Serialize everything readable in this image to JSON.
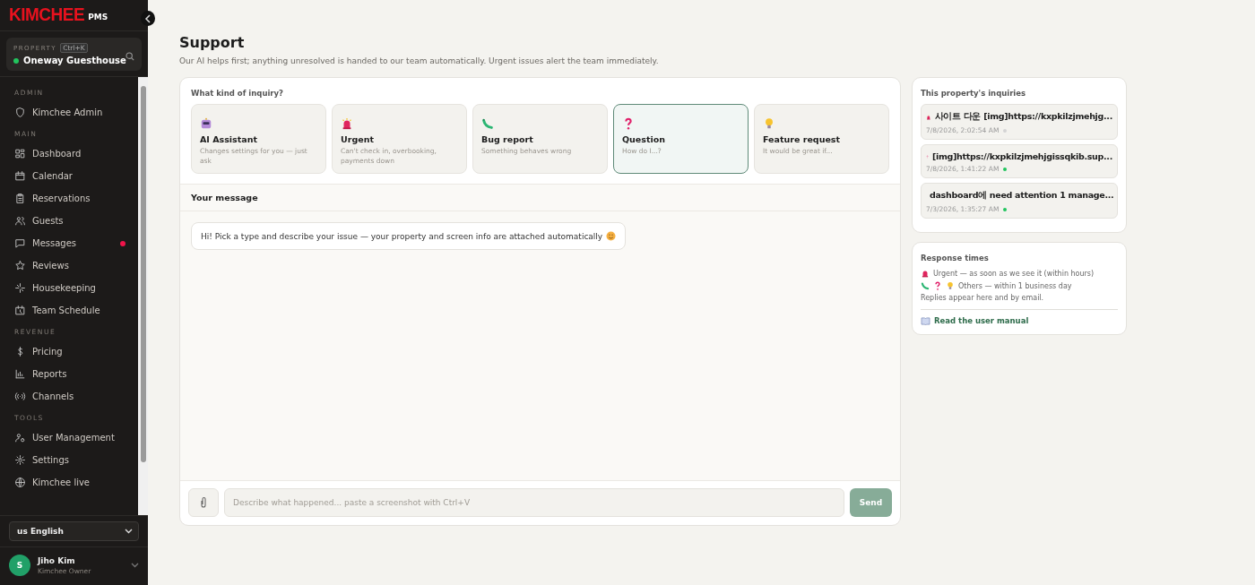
{
  "sidebar": {
    "logo": "KIMCHEE",
    "logo_suffix": "PMS",
    "property": {
      "label": "PROPERTY",
      "shortcut": "Ctrl+K",
      "name": "Oneway Guesthouse",
      "color": "#22c55e"
    },
    "sections": [
      {
        "title": "ADMIN",
        "items": [
          {
            "label": "Kimchee Admin",
            "unread": false
          }
        ]
      },
      {
        "title": "MAIN",
        "items": [
          {
            "label": "Dashboard",
            "unread": false
          },
          {
            "label": "Calendar",
            "unread": false
          },
          {
            "label": "Reservations",
            "unread": false
          },
          {
            "label": "Guests",
            "unread": false
          },
          {
            "label": "Messages",
            "unread": true
          },
          {
            "label": "Reviews",
            "unread": false
          },
          {
            "label": "Housekeeping",
            "unread": false
          },
          {
            "label": "Team Schedule",
            "unread": false
          }
        ]
      },
      {
        "title": "REVENUE",
        "items": [
          {
            "label": "Pricing",
            "unread": false
          },
          {
            "label": "Reports",
            "unread": false
          },
          {
            "label": "Channels",
            "unread": false
          }
        ]
      },
      {
        "title": "TOOLS",
        "items": [
          {
            "label": "User Management",
            "unread": false
          },
          {
            "label": "Settings",
            "unread": false
          },
          {
            "label": "Kimchee live",
            "unread": false
          }
        ]
      }
    ],
    "language": "us English",
    "user": {
      "initial": "S",
      "name": "Jiho Kim",
      "role": "Kimchee Owner"
    }
  },
  "page": {
    "title": "Support",
    "subtitle": "Our AI helps first; anything unresolved is handed to our team automatically. Urgent issues alert the team immediately."
  },
  "inquiry": {
    "heading": "What kind of inquiry?",
    "types": [
      {
        "kind": "robot",
        "title": "AI Assistant",
        "description": "Changes settings for you — just ask",
        "selected": false
      },
      {
        "kind": "siren",
        "title": "Urgent",
        "description": "Can't check in, overbooking, payments down",
        "selected": false
      },
      {
        "kind": "bug",
        "title": "Bug report",
        "description": "Something behaves wrong",
        "selected": false
      },
      {
        "kind": "question",
        "title": "Question",
        "description": "How do I...?",
        "selected": true
      },
      {
        "kind": "bulb",
        "title": "Feature request",
        "description": "It would be great if...",
        "selected": false
      }
    ]
  },
  "message": {
    "heading": "Your message",
    "bubble": "Hi! Pick a type and describe your issue — your property and screen info are attached automatically",
    "placeholder": "Describe what happened... paste a screenshot with Ctrl+V",
    "send": "Send"
  },
  "inquiries": {
    "title": "This property's inquiries",
    "items": [
      {
        "kind": "siren",
        "text": "사이트 다운 [img]https://kxpkilzjmehjg...",
        "time": "7/8/2026, 2:02:54 AM",
        "color": "#d4d4d4"
      },
      {
        "kind": "question",
        "text": "[img]https://kxpkilzjmehjgissqkib.sup...",
        "time": "7/8/2026, 1:41:22 AM",
        "color": "#22c55e"
      },
      {
        "kind": "question",
        "text": "dashboard에 need attention 1 manage...",
        "time": "7/3/2026, 1:35:27 AM",
        "color": "#22c55e"
      }
    ]
  },
  "response_times": {
    "title": "Response times",
    "lines": [
      {
        "kind": "urgent",
        "text": "Urgent — as soon as we see it (within hours)"
      },
      {
        "kind": "others",
        "text": "Others — within 1 business day"
      },
      {
        "kind": "note",
        "text": "Replies appear here and by email."
      }
    ],
    "manual_link": "Read the user manual"
  }
}
